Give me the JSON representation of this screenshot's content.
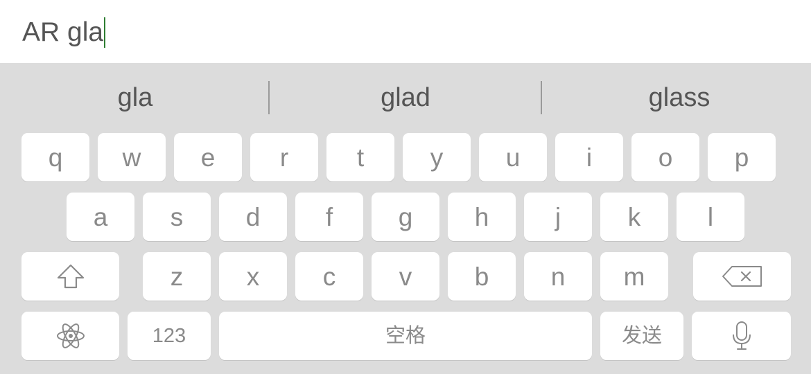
{
  "input": {
    "text": "AR gla",
    "caret_color": "#2e7d32"
  },
  "suggestions": [
    "gla",
    "glad",
    "glass"
  ],
  "keyboard": {
    "background": "#dcdcdc",
    "row1": [
      "q",
      "w",
      "e",
      "r",
      "t",
      "y",
      "u",
      "i",
      "o",
      "p"
    ],
    "row2": [
      "a",
      "s",
      "d",
      "f",
      "g",
      "h",
      "j",
      "k",
      "l"
    ],
    "row3": [
      "z",
      "x",
      "c",
      "v",
      "b",
      "n",
      "m"
    ],
    "icons": {
      "shift": "shift-arrow-icon",
      "backspace": "backspace-icon",
      "emoji": "atom-icon",
      "voice": "microphone-icon"
    },
    "numbers_label": "123",
    "space_label": "空格",
    "send_label": "发送"
  }
}
